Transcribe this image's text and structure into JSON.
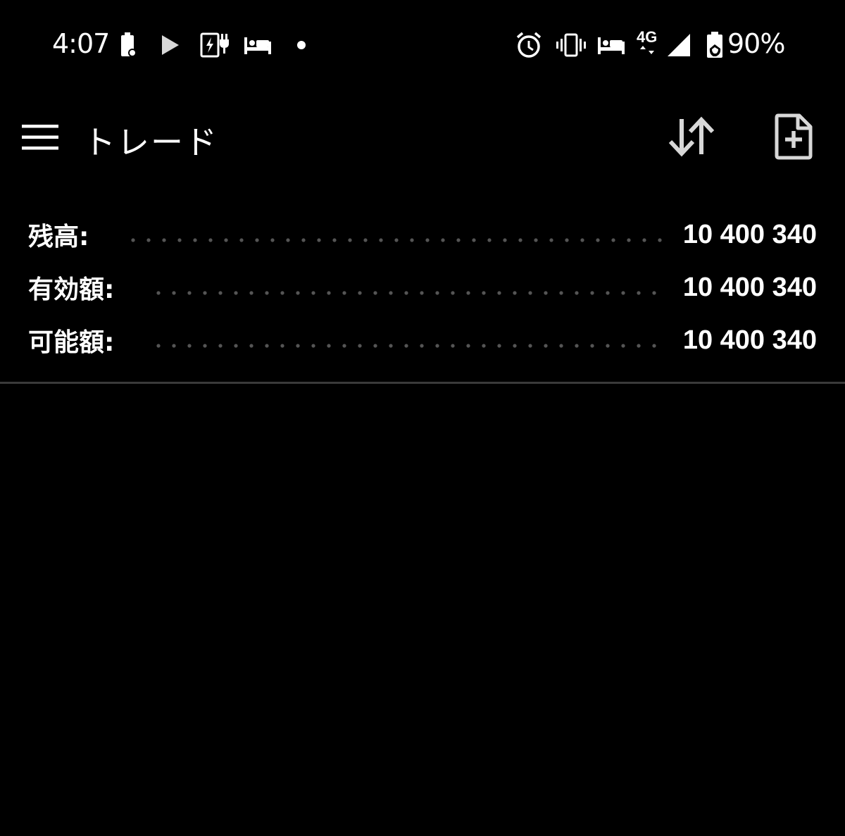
{
  "status_bar": {
    "time": "4:07",
    "battery_percent": "90%",
    "network_label": "4G",
    "left_icons": [
      "battery-saver-icon",
      "play-store-icon",
      "charging-icon",
      "bed-icon",
      "dot-icon"
    ],
    "right_icons": [
      "alarm-icon",
      "vibrate-icon",
      "bed-icon",
      "network-4g-icon",
      "signal-icon",
      "battery-icon"
    ]
  },
  "toolbar": {
    "title": "トレード",
    "menu_icon": "hamburger-menu-icon",
    "sort_icon": "sort-arrows-icon",
    "new_doc_icon": "add-document-icon"
  },
  "balances": [
    {
      "label": "残高:",
      "value": "10 400 340"
    },
    {
      "label": "有効額:",
      "value": "10 400 340"
    },
    {
      "label": "可能額:",
      "value": "10 400 340"
    }
  ],
  "colors": {
    "background": "#000000",
    "text": "#ffffff",
    "dots": "#555555",
    "divider": "#3a3a3a",
    "icon_gray": "#d8d8d8"
  }
}
